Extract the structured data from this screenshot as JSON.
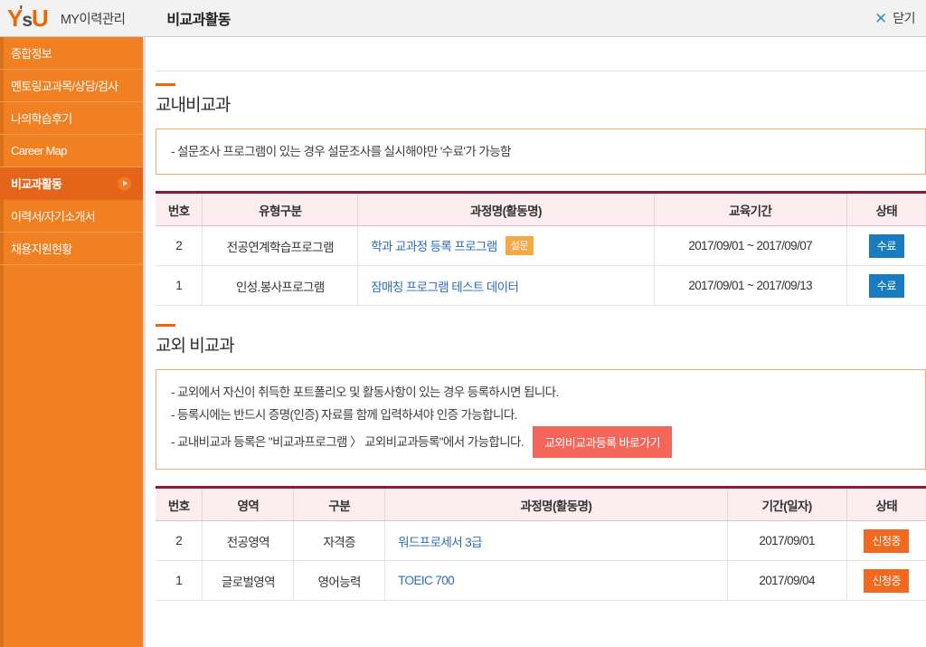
{
  "header": {
    "logo": {
      "part1": "Y",
      "part2": "s",
      "part3": "U",
      "name": "YSU"
    },
    "subtitle": "MY이력관리",
    "title": "비교과활동",
    "close_icon": "close-icon",
    "close_label": "닫기"
  },
  "sidebar": {
    "items": [
      {
        "label": "종합정보",
        "active": false
      },
      {
        "label": "멘토링교과목/상담/검사",
        "active": false
      },
      {
        "label": "나의학습후기",
        "active": false
      },
      {
        "label": "Career Map",
        "active": false
      },
      {
        "label": "비교과활동",
        "active": true
      },
      {
        "label": "이력서/자기소개서",
        "active": false
      },
      {
        "label": "채용지원현황",
        "active": false
      }
    ]
  },
  "section_internal": {
    "title": "교내비교과",
    "notice": "- 설문조사 프로그램이 있는 경우 설문조사를 실시해야만 '수료'가 가능함",
    "table": {
      "headers": [
        "번호",
        "유형구분",
        "과정명(활동명)",
        "교육기간",
        "상태"
      ],
      "rows": [
        {
          "no": "2",
          "type": "전공연계학습프로그램",
          "course": "학과 교과정 등록 프로그램",
          "course_badge": "설문",
          "period": "2017/09/01 ~ 2017/09/07",
          "state": "수료"
        },
        {
          "no": "1",
          "type": "인성.봉사프로그램",
          "course": "잠매칭 프로그램 테스트 데이터",
          "course_badge": "",
          "period": "2017/09/01 ~ 2017/09/13",
          "state": "수료"
        }
      ]
    }
  },
  "section_external": {
    "title": "교외 비교과",
    "notice_lines": [
      "- 교외에서 자신이 취득한 포트폴리오 및 활동사항이 있는 경우 등록하시면 됩니다.",
      "- 등록시에는 반드시 증명(인증) 자료를 함께 입력하셔야 인증 가능합니다.",
      "- 교내비교과 등록은 \"비교과프로그램 〉 교외비교과등록\"에서 가능합니다."
    ],
    "shortcut_button": "교외비교과등록 바로가기",
    "table": {
      "headers": [
        "번호",
        "영역",
        "구분",
        "과정명(활동명)",
        "기간(일자)",
        "상태"
      ],
      "rows": [
        {
          "no": "2",
          "area": "전공영역",
          "category": "자격증",
          "course": "워드프로세서 3급",
          "date": "2017/09/01",
          "state": "신청중"
        },
        {
          "no": "1",
          "area": "글로벌영역",
          "category": "영어능력",
          "course": "TOEIC 700",
          "date": "2017/09/04",
          "state": "신청중"
        }
      ]
    }
  },
  "colors": {
    "brand_orange": "#f08022",
    "sidebar_active": "#e4651a",
    "table_top_border": "#8d1b35",
    "table_header_bg": "#fbedef",
    "link_blue": "#2b6cb8",
    "badge_done_blue": "#1a7cc0",
    "badge_apply_orange": "#f0691e",
    "badge_survey_orange": "#f6a845",
    "shortcut_btn_red": "#f4655a",
    "close_icon_blue": "#3c8fd4"
  }
}
